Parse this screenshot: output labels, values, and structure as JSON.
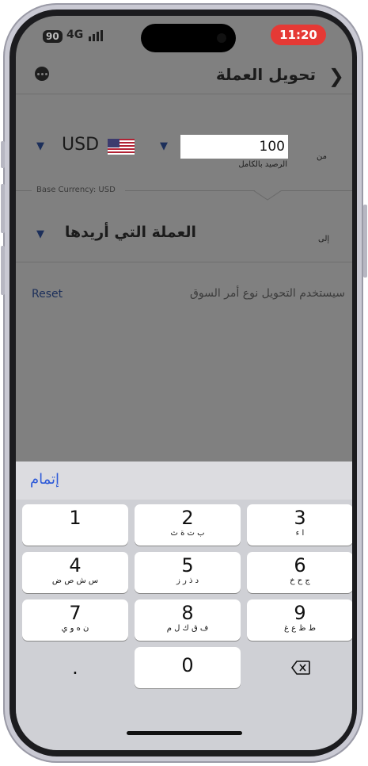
{
  "status_bar": {
    "sim_badge": "90",
    "network": "4G",
    "time": "11:20"
  },
  "header": {
    "back_icon": "chevron-right-icon",
    "title": "تحويل العملة",
    "menu_icon": "more-icon"
  },
  "from_section": {
    "label": "من",
    "currency_code": "USD",
    "amount": "100",
    "balance_label": "الرصيد بالكامل"
  },
  "base_currency": "Base Currency: USD",
  "to_section": {
    "label": "إلى",
    "placeholder": "العملة التي أريدها"
  },
  "footer": {
    "reset_label": "Reset",
    "note": "سيستخدم التحويل نوع أمر السوق"
  },
  "keyboard": {
    "done_label": "إتمام",
    "keys": [
      {
        "num": "1",
        "sub": ""
      },
      {
        "num": "2",
        "sub": "ب ت ة ث"
      },
      {
        "num": "3",
        "sub": "ا ء"
      },
      {
        "num": "4",
        "sub": "س ش ص ض"
      },
      {
        "num": "5",
        "sub": "د ذ ر ز"
      },
      {
        "num": "6",
        "sub": "ج ح خ"
      },
      {
        "num": "7",
        "sub": "ن ه و ي"
      },
      {
        "num": "8",
        "sub": "ف ق ك ل م"
      },
      {
        "num": "9",
        "sub": "ط ظ ع غ"
      }
    ],
    "dot_key": ".",
    "zero_key": "0",
    "delete_icon": "backspace-icon"
  },
  "colors": {
    "status_time_bg": "#e53935",
    "accent": "#1c2f5a",
    "done": "#2f5bd8"
  }
}
